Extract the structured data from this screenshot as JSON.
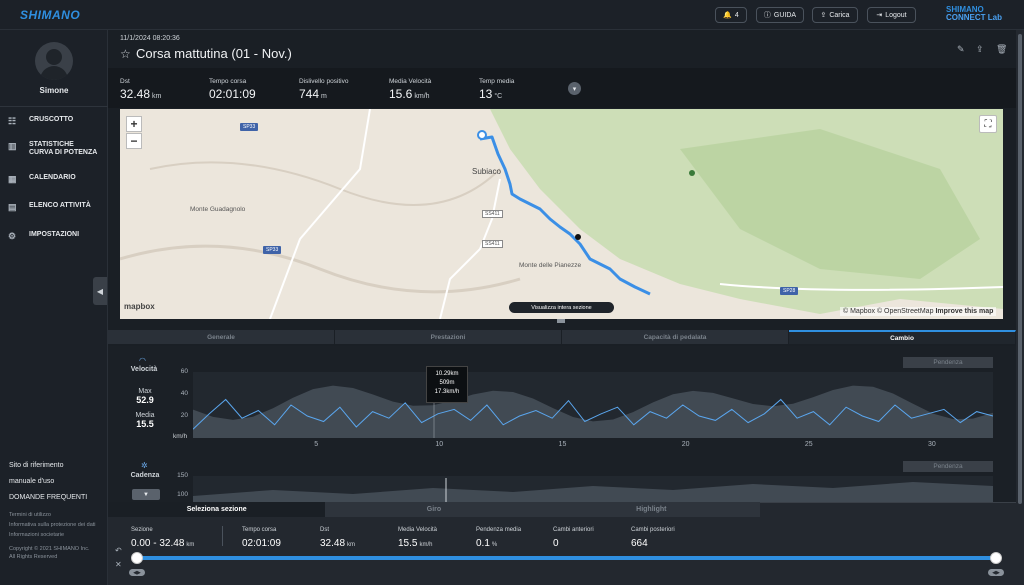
{
  "header": {
    "brand": "SHIMANO",
    "notif_count": "4",
    "guida": "GUIDA",
    "carica": "Carica",
    "logout": "Logout",
    "connect_line1": "SHIMANO",
    "connect_line2": "CONNECT Lab"
  },
  "sidebar": {
    "username": "Simone",
    "items": [
      {
        "label": "CRUSCOTTO",
        "icon": "dashboard-icon"
      },
      {
        "label": "STATISTICHE CURVA DI POTENZA",
        "icon": "chart-icon"
      },
      {
        "label": "CALENDARIO",
        "icon": "calendar-icon"
      },
      {
        "label": "ELENCO ATTIVITÀ",
        "icon": "list-icon"
      },
      {
        "label": "IMPOSTAZIONI",
        "icon": "gear-icon"
      }
    ],
    "links": [
      "Sito di riferimento",
      "manuale d'uso",
      "DOMANDE FREQUENTI"
    ],
    "legal": [
      "Termini di utilizzo",
      "Informativa sulla protezione dei dati",
      "Informazioni societarie"
    ],
    "copyright": "Copyright © 2021 SHIMANO Inc.",
    "rights": "All Rights Reserved"
  },
  "activity": {
    "datetime": "11/1/2024 08:20:36",
    "title": "Corsa mattutina (01 - Nov.)"
  },
  "stats": [
    {
      "label": "Dst",
      "value": "32.48",
      "unit": "km"
    },
    {
      "label": "Tempo corsa",
      "value": "02:01:09",
      "unit": ""
    },
    {
      "label": "Dislivello positivo",
      "value": "744",
      "unit": "m"
    },
    {
      "label": "Media Velocità",
      "value": "15.6",
      "unit": "km/h"
    },
    {
      "label": "Temp media",
      "value": "13",
      "unit": "°C"
    }
  ],
  "map": {
    "zoom_in": "+",
    "zoom_out": "−",
    "labels": {
      "subiaco": "Subiaco",
      "monte_guadagnolo": "Monte Guadagnolo",
      "monte_pianezze": "Monte delle Pianezze"
    },
    "roads": [
      "SP33",
      "SP33",
      "SS411",
      "SS411",
      "SP28"
    ],
    "mapbox": "mapbox",
    "attribution": "© Mapbox © OpenStreetMap",
    "improve": "Improve this map",
    "show_section_button": "Visualizza intera sezione"
  },
  "tabs": [
    "Generale",
    "Prestazioni",
    "Capacità di pedalata",
    "Cambio"
  ],
  "chart_data": {
    "type": "area",
    "title": "Velocità",
    "ylabel": "km/h",
    "ylim": [
      0,
      60
    ],
    "yticks": [
      "60",
      "40",
      "20"
    ],
    "xticks": [
      "5",
      "10",
      "15",
      "20",
      "25",
      "30"
    ],
    "xlim": [
      0,
      32.48
    ],
    "max_label": "Max",
    "max_value": "52.9",
    "media_label": "Media",
    "media_value": "15.5",
    "pendenza_label": "Pendenza",
    "tooltip": {
      "distance": "10.29km",
      "altitude": "509m",
      "speed": "17.3km/h"
    },
    "series": [
      {
        "values": [
          8,
          22,
          35,
          18,
          25,
          12,
          30,
          20,
          15,
          28,
          10,
          24,
          18,
          32,
          14,
          22,
          26,
          16,
          30,
          12,
          20,
          25,
          18,
          34,
          15,
          22,
          28,
          12,
          24,
          18,
          30,
          20,
          16,
          26,
          14,
          22,
          35,
          18,
          24,
          12,
          28,
          20,
          15,
          30,
          18,
          22,
          26,
          14,
          24,
          20
        ]
      }
    ]
  },
  "cadenza": {
    "label": "Cadenza",
    "yticks": [
      "150",
      "100"
    ],
    "pendenza_label": "Pendenza"
  },
  "bottom": {
    "tabs": [
      "Seleziona sezione",
      "Giro",
      "Highlight"
    ],
    "stats": [
      {
        "label": "Sezione",
        "value": "0.00 - 32.48",
        "unit": "km"
      },
      {
        "label": "Tempo corsa",
        "value": "02:01:09",
        "unit": ""
      },
      {
        "label": "Dst",
        "value": "32.48",
        "unit": "km"
      },
      {
        "label": "Media Velocità",
        "value": "15.5",
        "unit": "km/h"
      },
      {
        "label": "Pendenza media",
        "value": "0.1",
        "unit": "%"
      },
      {
        "label": "Cambi anteriori",
        "value": "0",
        "unit": ""
      },
      {
        "label": "Cambi posteriori",
        "value": "664",
        "unit": ""
      }
    ],
    "range_start_fraction": 0,
    "range_end_fraction": 1
  }
}
